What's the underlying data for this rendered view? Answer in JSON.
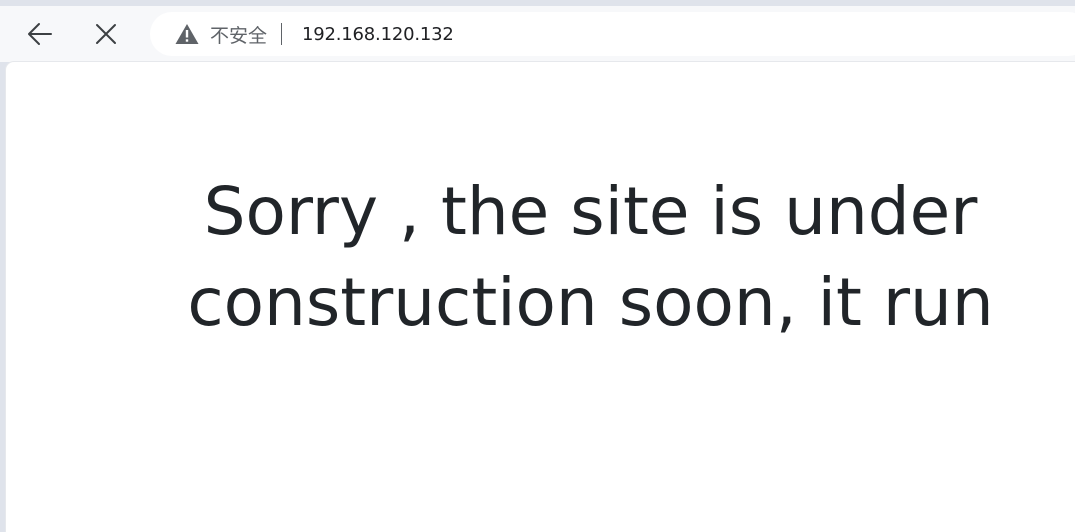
{
  "browser": {
    "security_label": "不安全",
    "url": "192.168.120.132",
    "icons": {
      "back": "arrow-left-icon",
      "stop": "close-icon",
      "security": "warning-triangle-icon"
    },
    "colors": {
      "toolbar_bg": "#f7f8fa",
      "frame_bg": "#dfe3eb",
      "omnibox_bg": "#ffffff",
      "icon": "#3c4043",
      "security_text": "#5f6368"
    }
  },
  "page": {
    "headline_lines": [
      "Sorry , the site is under",
      "construction soon, it run"
    ],
    "colors": {
      "background": "#ffffff",
      "text": "#212529"
    }
  }
}
